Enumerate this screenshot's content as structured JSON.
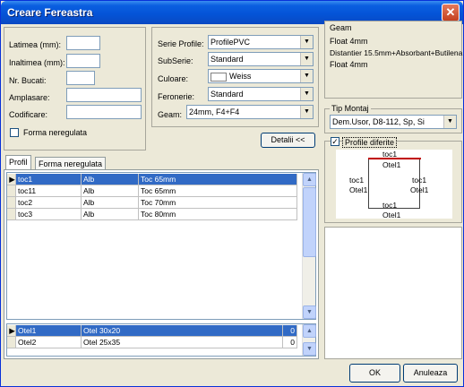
{
  "window": {
    "title": "Creare Fereastra",
    "close_glyph": "✕"
  },
  "left_form": {
    "latimea": "Latimea (mm):",
    "inaltimea": "Inaltimea (mm):",
    "nr_bucati": "Nr. Bucati:",
    "amplasare": "Amplasare:",
    "codificare": "Codificare:",
    "forma_neregulata": "Forma neregulata"
  },
  "profile_form": {
    "serie_profile_label": "Serie Profile:",
    "serie_profile_value": "ProfilePVC",
    "subserie_label": "SubSerie:",
    "subserie_value": "Standard",
    "culoare_label": "Culoare:",
    "culoare_value": "Weiss",
    "feronerie_label": "Feronerie:",
    "feronerie_value": "Standard",
    "geam_label": "Geam:",
    "geam_value": "24mm, F4+F4"
  },
  "detalii_button": "Detalii <<",
  "geam_info": {
    "heading": "Geam",
    "lines": [
      "Float 4mm",
      "Distantier 15.5mm+Absorbant+Butilena",
      "Float 4mm"
    ]
  },
  "tip_montaj": {
    "label": "Tip Montaj",
    "value": "Dem.Usor, D8-112, Sp, Si"
  },
  "profile_diferite": {
    "label": "Profile diferite",
    "checked": "✓"
  },
  "preview": {
    "top_profile": "toc1",
    "top_reinforcement": "Otel1",
    "left_profile": "toc1",
    "left_reinforcement": "Otel1",
    "right_profile": "toc1",
    "right_reinforcement": "Otel1",
    "bottom_profile": "toc1",
    "bottom_reinforcement": "Otel1",
    "top_color": "#c00000"
  },
  "tabs": [
    "Profil",
    "Forma neregulata"
  ],
  "profile_grid": {
    "rows": [
      {
        "code": "toc1",
        "color": "Alb",
        "desc": "Toc 65mm"
      },
      {
        "code": "toc11",
        "color": "Alb",
        "desc": "Toc 65mm"
      },
      {
        "code": "toc2",
        "color": "Alb",
        "desc": "Toc 70mm"
      },
      {
        "code": "toc3",
        "color": "Alb",
        "desc": "Toc 80mm"
      }
    ]
  },
  "steel_grid": {
    "rows": [
      {
        "code": "Otel1",
        "desc": "Otel 30x20",
        "qty": "0"
      },
      {
        "code": "Otel2",
        "desc": "Otel 25x35",
        "qty": "0"
      }
    ]
  },
  "buttons": {
    "ok": "OK",
    "cancel": "Anuleaza"
  },
  "colors": {
    "selection": "#316ac5",
    "titlebar": "#0453d6"
  }
}
